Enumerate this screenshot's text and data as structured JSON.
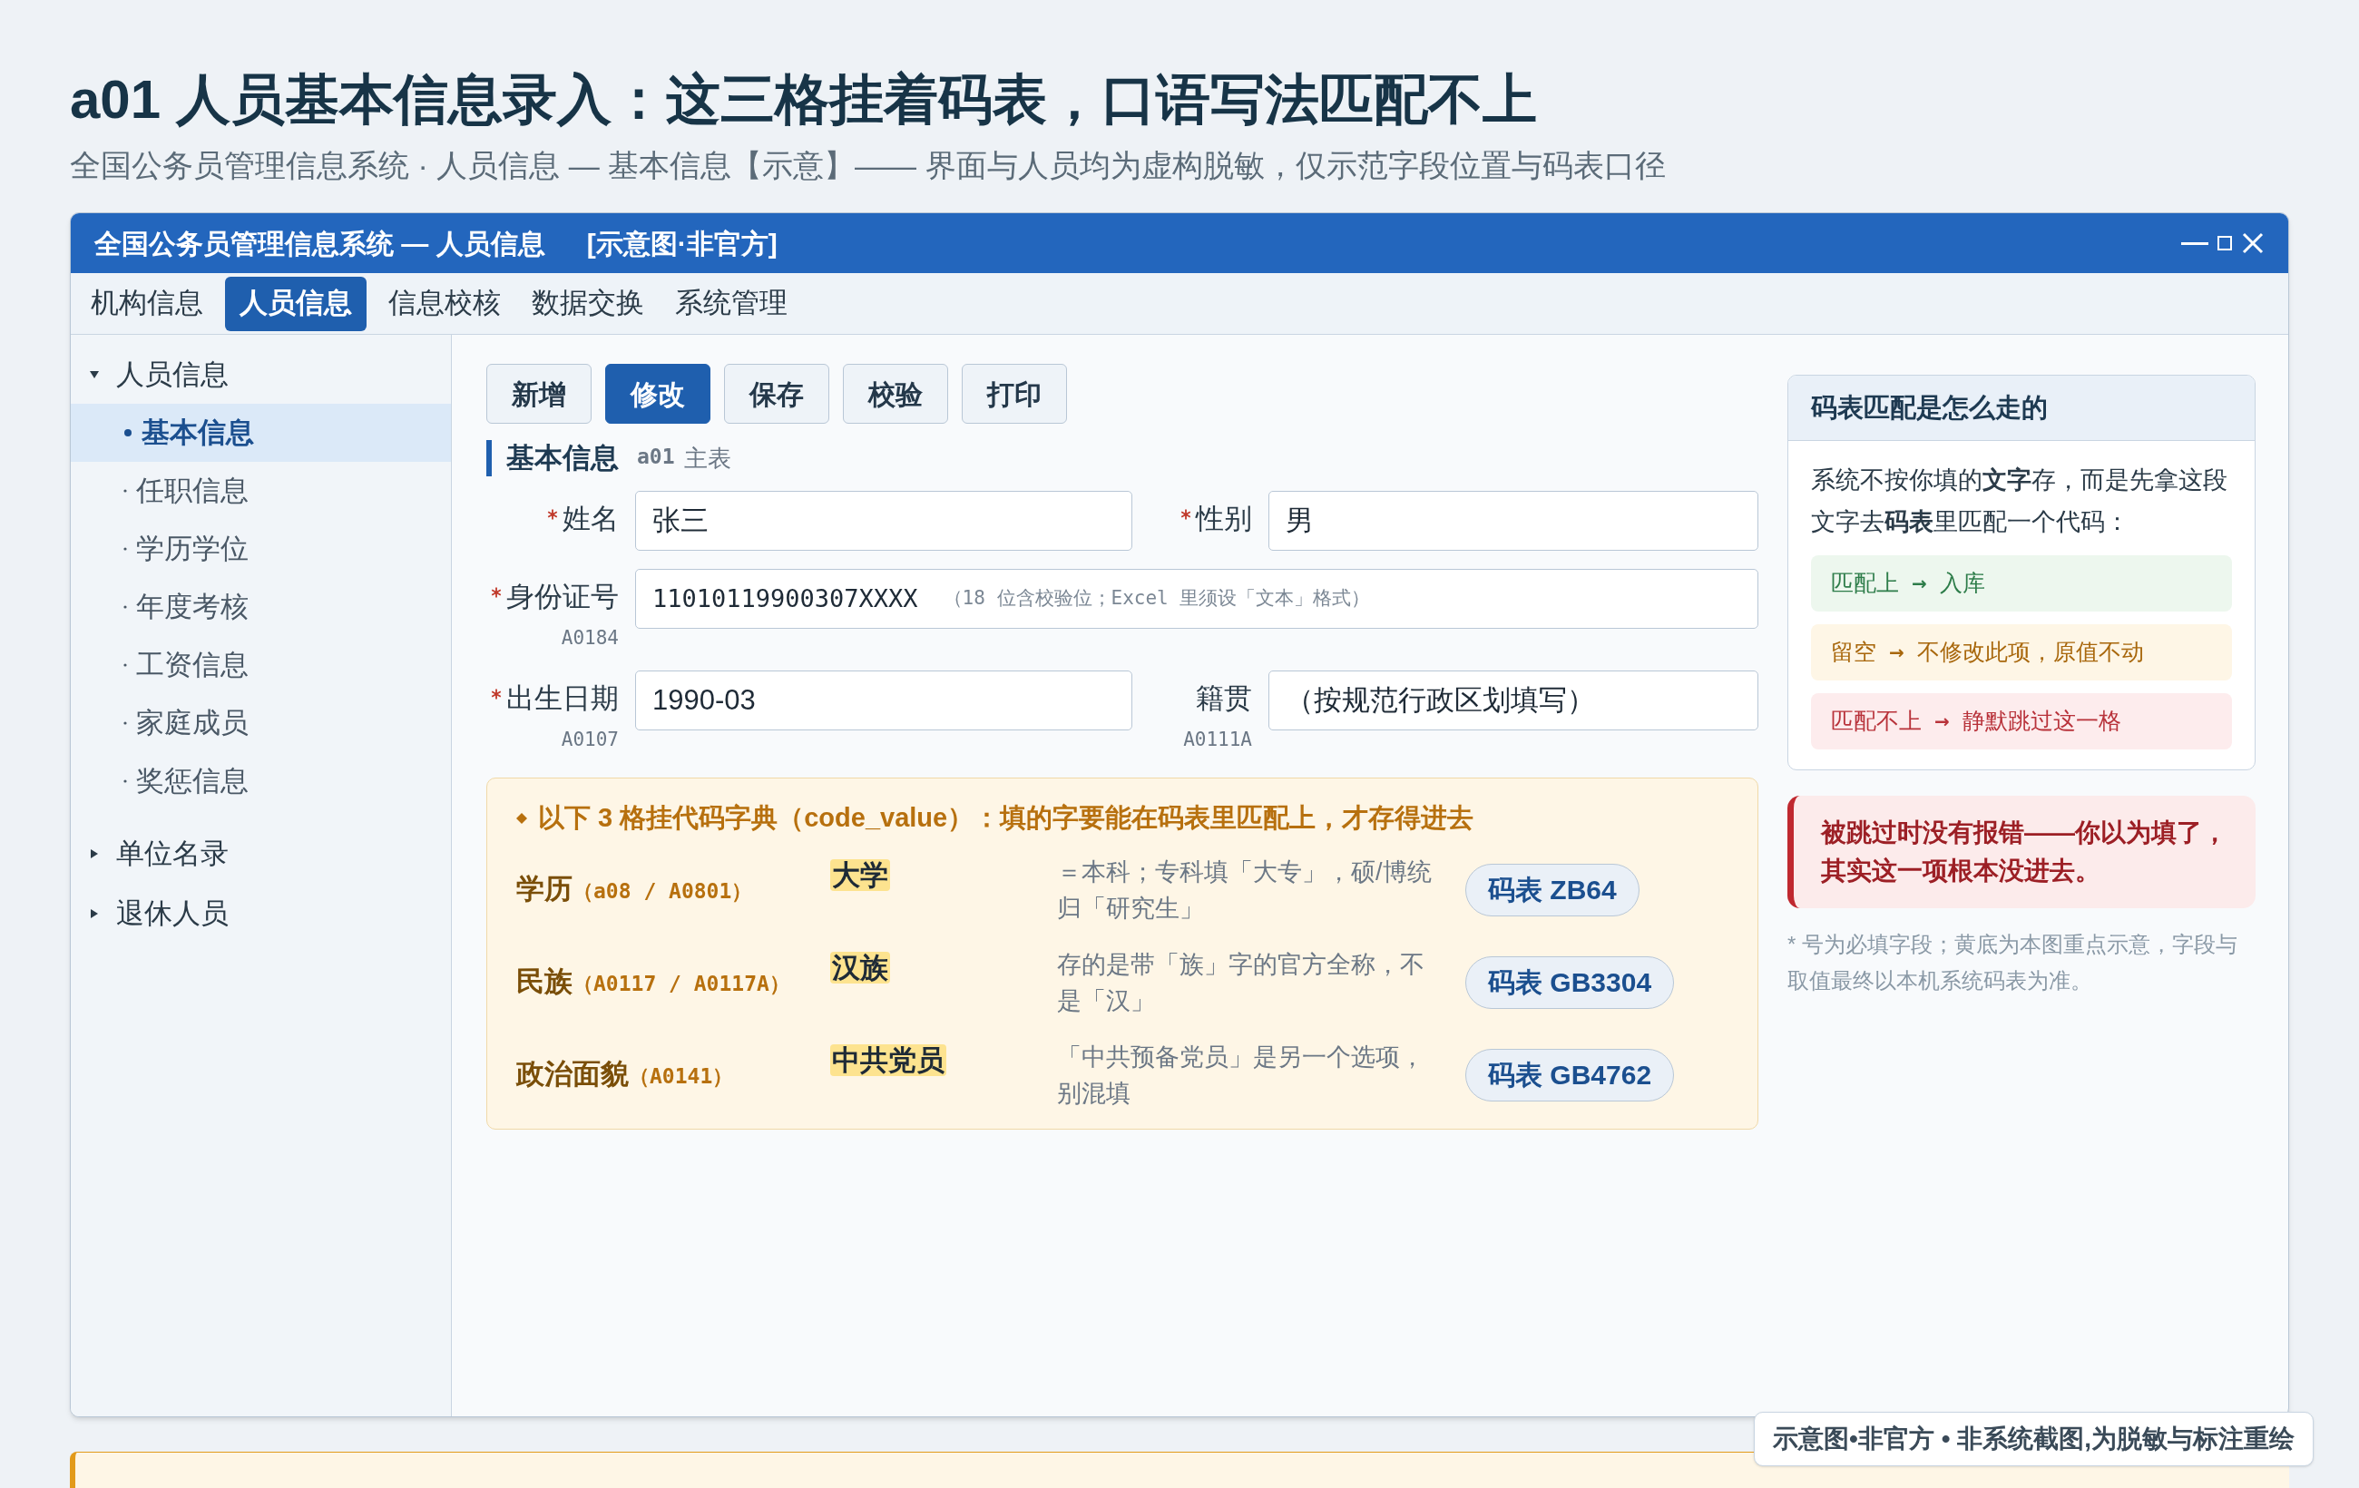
{
  "page": {
    "title": "a01 人员基本信息录入：这三格挂着码表，口语写法匹配不上",
    "subtitle": "全国公务员管理信息系统 · 人员信息 — 基本信息【示意】—— 界面与人员均为虚构脱敏，仅示范字段位置与码表口径"
  },
  "window": {
    "title": "全国公务员管理信息系统 — 人员信息",
    "tag": "[示意图·非官方]"
  },
  "tabs": [
    {
      "label": "机构信息",
      "selected": false
    },
    {
      "label": "人员信息",
      "selected": true
    },
    {
      "label": "信息校核",
      "selected": false
    },
    {
      "label": "数据交换",
      "selected": false
    },
    {
      "label": "系统管理",
      "selected": false
    }
  ],
  "sidebar": {
    "items": [
      {
        "label": "人员信息",
        "expanded": true,
        "children": [
          {
            "label": "基本信息",
            "selected": true
          },
          {
            "label": "任职信息",
            "selected": false
          },
          {
            "label": "学历学位",
            "selected": false
          },
          {
            "label": "年度考核",
            "selected": false
          },
          {
            "label": "工资信息",
            "selected": false
          },
          {
            "label": "家庭成员",
            "selected": false
          },
          {
            "label": "奖惩信息",
            "selected": false
          }
        ]
      },
      {
        "label": "单位名录",
        "expanded": false
      },
      {
        "label": "退休人员",
        "expanded": false
      }
    ]
  },
  "toolbar": [
    {
      "label": "新增",
      "selected": false
    },
    {
      "label": "修改",
      "selected": true
    },
    {
      "label": "保存",
      "selected": false
    },
    {
      "label": "校验",
      "selected": false
    },
    {
      "label": "打印",
      "selected": false
    }
  ],
  "section": {
    "title": "基本信息",
    "code": "a01",
    "note": "主表"
  },
  "form_rows": [
    [
      {
        "label": "姓名",
        "required": true,
        "value": "张三"
      },
      {
        "label": "性别",
        "required": true,
        "value": "男"
      }
    ],
    [
      {
        "label": "身份证号",
        "required": true,
        "code": "A0184",
        "value": "11010119900307XXXX",
        "hint": "（18 位含校验位；Excel 里须设「文本」格式）"
      }
    ],
    [
      {
        "label": "出生日期",
        "required": true,
        "code": "A0107",
        "value": "1990-03"
      },
      {
        "label": "籍贯",
        "required": false,
        "code": "A0111A",
        "value": "（按规范行政区划填写）"
      }
    ]
  ],
  "code_box": {
    "heading": "以下 3 格挂代码字典（code_value）：填的字要能在码表里匹配上，才存得进去",
    "rows": [
      {
        "label": "学历",
        "code": "（a08 / A0801）",
        "value": "大学",
        "note": "＝本科；专科填「大专」，硕/博统归「研究生」",
        "table": "码表 ZB64"
      },
      {
        "label": "民族",
        "code": "（A0117 / A0117A）",
        "value": "汉族",
        "note": "存的是带「族」字的官方全称，不是「汉」",
        "table": "码表 GB3304"
      },
      {
        "label": "政治面貌",
        "code": "（A0141）",
        "value": "中共党员",
        "note": "「中共预备党员」是另一个选项，别混填",
        "table": "码表 GB4762"
      }
    ]
  },
  "side_panel": {
    "title": "码表匹配是怎么走的",
    "body": "系统不按你填的**文字**存，而是先拿这段文字去**码表**里匹配一个代码：",
    "flows": [
      {
        "kind": "ok",
        "from": "匹配上",
        "arrow": "→",
        "to": "入库"
      },
      {
        "kind": "keep",
        "from": "留空",
        "arrow": "→",
        "to": "不修改此项，原值不动"
      },
      {
        "kind": "fail",
        "from": "匹配不上",
        "arrow": "→",
        "to": "静默跳过这一格"
      }
    ]
  },
  "warning": "被跳过时没有报错——你以为填了，其实这一项根本没进去。",
  "footnote": "* 号为必填字段；黄底为本图重点示意，字段与取值最终以本机系统码表为准。",
  "badge": "示意图•非官方 • 非系统截图,为脱敏与标注重绘"
}
